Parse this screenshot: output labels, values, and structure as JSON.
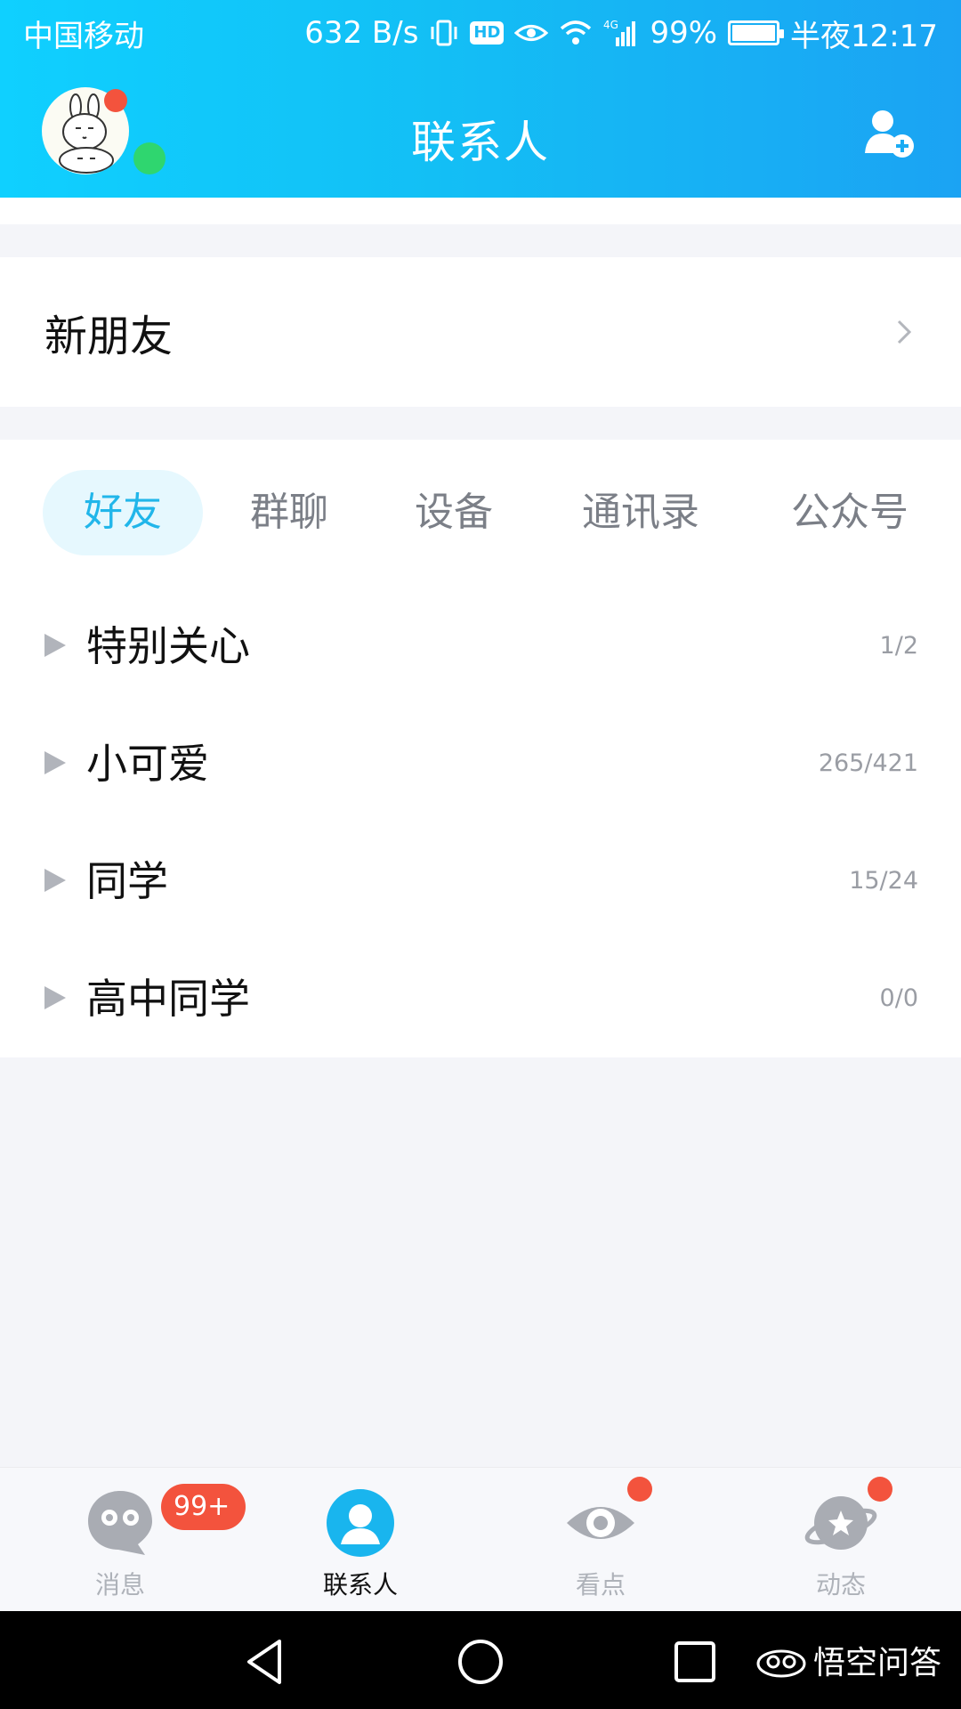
{
  "status_bar": {
    "carrier": "中国移动",
    "speed": "632 B/s",
    "hd": "HD",
    "network": "4G",
    "battery": "99%",
    "battery_level": 0.99,
    "time": "半夜12:17"
  },
  "header": {
    "title": "联系人",
    "avatar_icon": "rabbit-avatar-icon",
    "add_icon": "add-contact-icon"
  },
  "new_friend": {
    "label": "新朋友"
  },
  "tabs": [
    {
      "label": "好友",
      "active": true
    },
    {
      "label": "群聊",
      "active": false
    },
    {
      "label": "设备",
      "active": false
    },
    {
      "label": "通讯录",
      "active": false
    },
    {
      "label": "公众号",
      "active": false
    }
  ],
  "groups": [
    {
      "name": "特别关心",
      "count": "1/2"
    },
    {
      "name": "小可爱",
      "count": "265/421"
    },
    {
      "name": "同学",
      "count": "15/24"
    },
    {
      "name": "高中同学",
      "count": "0/0"
    }
  ],
  "bottom_nav": [
    {
      "label": "消息",
      "icon": "message-icon",
      "badge": "99+",
      "active": false
    },
    {
      "label": "联系人",
      "icon": "contacts-icon",
      "active": true
    },
    {
      "label": "看点",
      "icon": "eye-icon",
      "dot": true,
      "active": false
    },
    {
      "label": "动态",
      "icon": "planet-icon",
      "dot": true,
      "active": false
    }
  ],
  "watermark": "悟空问答",
  "colors": {
    "accent": "#21b6ea",
    "header_start": "#0fd0ff",
    "header_end": "#1ba3f3",
    "badge": "#f3533d",
    "online": "#2fd66f"
  }
}
